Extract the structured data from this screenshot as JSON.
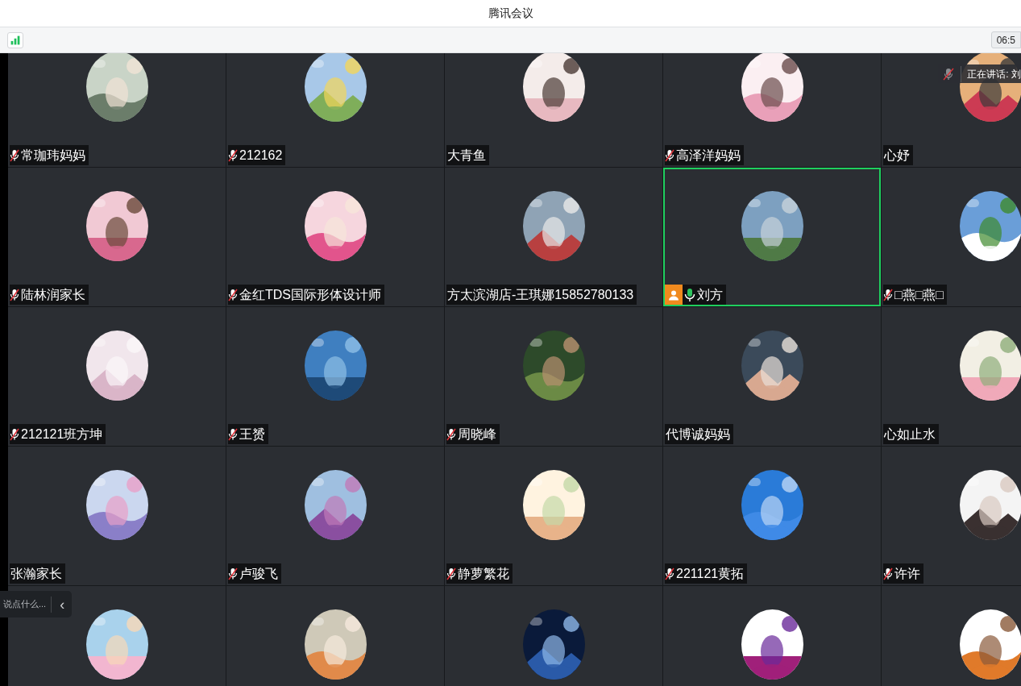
{
  "window": {
    "title": "腾讯会议"
  },
  "toolbar": {
    "timer": "06:5"
  },
  "speaking_banner": {
    "text": "正在讲话: 刘"
  },
  "tiles": [
    {
      "name": "常珈玮妈妈",
      "muted": true,
      "speaking": false,
      "host": false,
      "selected": false
    },
    {
      "name": "212162",
      "muted": true,
      "speaking": false,
      "host": false,
      "selected": false
    },
    {
      "name": "大青鱼",
      "muted": false,
      "speaking": false,
      "host": false,
      "selected": false
    },
    {
      "name": "高泽洋妈妈",
      "muted": true,
      "speaking": false,
      "host": false,
      "selected": false
    },
    {
      "name": "心妤",
      "muted": false,
      "speaking": false,
      "host": false,
      "selected": false
    },
    {
      "name": "陆林润家长",
      "muted": true,
      "speaking": false,
      "host": false,
      "selected": false
    },
    {
      "name": "金红TDS国际形体设计师",
      "muted": true,
      "speaking": false,
      "host": false,
      "selected": false
    },
    {
      "name": "方太滨湖店-王琪娜15852780133",
      "muted": false,
      "speaking": false,
      "host": false,
      "selected": false
    },
    {
      "name": "刘方",
      "muted": false,
      "speaking": true,
      "host": true,
      "selected": true
    },
    {
      "name": "□燕□燕□",
      "muted": true,
      "speaking": false,
      "host": false,
      "selected": false
    },
    {
      "name": "212121班方坤",
      "muted": true,
      "speaking": false,
      "host": false,
      "selected": false
    },
    {
      "name": "王赟",
      "muted": true,
      "speaking": false,
      "host": false,
      "selected": false
    },
    {
      "name": "周晓峰",
      "muted": true,
      "speaking": false,
      "host": false,
      "selected": false
    },
    {
      "name": "代博诚妈妈",
      "muted": false,
      "speaking": false,
      "host": false,
      "selected": false
    },
    {
      "name": "心如止水",
      "muted": false,
      "speaking": false,
      "host": false,
      "selected": false
    },
    {
      "name": "张瀚家长",
      "muted": false,
      "speaking": false,
      "host": false,
      "selected": false
    },
    {
      "name": "卢骏飞",
      "muted": true,
      "speaking": false,
      "host": false,
      "selected": false
    },
    {
      "name": "静萝繁花",
      "muted": true,
      "speaking": false,
      "host": false,
      "selected": false
    },
    {
      "name": "221121黄拓",
      "muted": true,
      "speaking": false,
      "host": false,
      "selected": false
    },
    {
      "name": "许许",
      "muted": true,
      "speaking": false,
      "host": false,
      "selected": false
    },
    {
      "selected": false
    },
    {
      "selected": false
    },
    {
      "selected": false
    },
    {
      "selected": false
    },
    {
      "selected": false
    }
  ],
  "chat": {
    "placeholder": "说点什么...",
    "collapse": "‹"
  }
}
